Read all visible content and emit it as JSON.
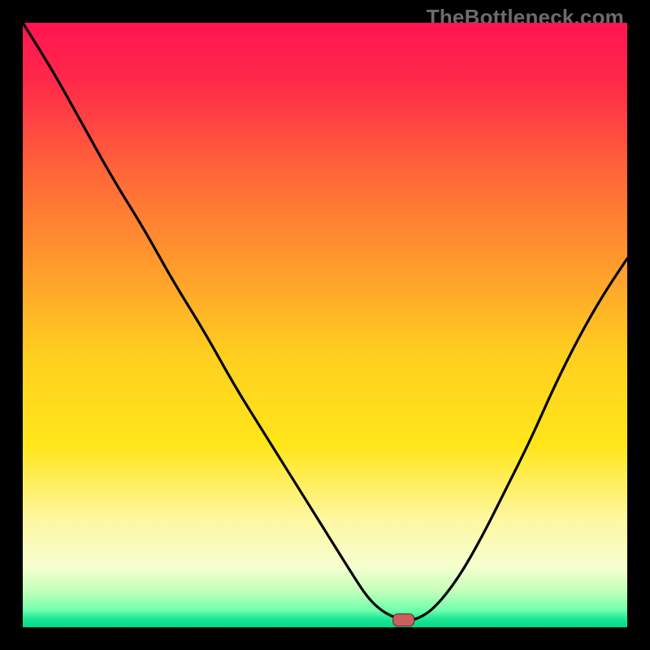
{
  "watermark": "TheBottleneck.com",
  "chart_data": {
    "type": "line",
    "title": "",
    "xlabel": "",
    "ylabel": "",
    "xlim": [
      0,
      100
    ],
    "ylim": [
      0,
      100
    ],
    "grid": false,
    "legend": false,
    "background": {
      "type": "vertical-gradient",
      "stops": [
        {
          "pos": 0.0,
          "color": "#ff1452"
        },
        {
          "pos": 0.1,
          "color": "#ff2a49"
        },
        {
          "pos": 0.25,
          "color": "#ff6739"
        },
        {
          "pos": 0.4,
          "color": "#ff9a2d"
        },
        {
          "pos": 0.55,
          "color": "#ffcf1f"
        },
        {
          "pos": 0.7,
          "color": "#ffe61a"
        },
        {
          "pos": 0.82,
          "color": "#fff7a0"
        },
        {
          "pos": 0.9,
          "color": "#f5ffd0"
        },
        {
          "pos": 0.94,
          "color": "#c4ffba"
        },
        {
          "pos": 0.972,
          "color": "#6fffad"
        },
        {
          "pos": 0.985,
          "color": "#22e896"
        },
        {
          "pos": 1.0,
          "color": "#00d989"
        }
      ]
    },
    "series": [
      {
        "name": "bottleneck-curve",
        "color": "#000000",
        "x": [
          0,
          5,
          10,
          15,
          20,
          25,
          30,
          35,
          40,
          45,
          50,
          55,
          57,
          59,
          61,
          63,
          65,
          68,
          72,
          76,
          80,
          84,
          88,
          92,
          96,
          100
        ],
        "y": [
          100,
          92,
          83,
          74,
          66,
          57,
          49,
          40,
          32,
          24,
          16,
          8,
          5,
          3,
          1.8,
          1.2,
          1.2,
          3,
          8,
          15,
          23,
          31,
          40,
          48,
          55,
          61
        ]
      }
    ],
    "marker": {
      "name": "optimal-point",
      "x": 63,
      "y": 1.2,
      "shape": "rounded-rect",
      "fill": "#c9605f",
      "stroke": "#7a2d2d"
    }
  }
}
